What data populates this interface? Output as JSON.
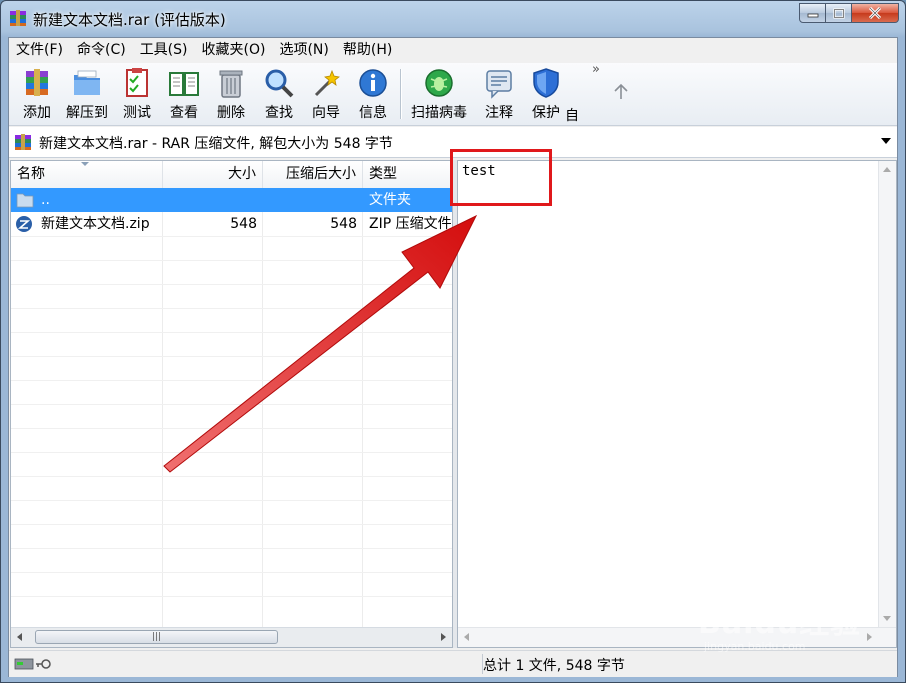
{
  "window": {
    "title": "新建文本文档.rar (评估版本)"
  },
  "menu": [
    "文件(F)",
    "命令(C)",
    "工具(S)",
    "收藏夹(O)",
    "选项(N)",
    "帮助(H)"
  ],
  "toolbar": {
    "add": "添加",
    "extract": "解压到",
    "test": "测试",
    "view": "查看",
    "delete": "删除",
    "find": "查找",
    "wizard": "向导",
    "info": "信息",
    "scan": "扫描病毒",
    "comment": "注释",
    "protect": "保护",
    "sfx": "自",
    "more": "»"
  },
  "address": {
    "text": "新建文本文档.rar - RAR 压缩文件, 解包大小为 548 字节"
  },
  "columns": {
    "name": "名称",
    "size": "大小",
    "packed": "压缩后大小",
    "type": "类型"
  },
  "files": [
    {
      "name": "..",
      "size": "",
      "packed": "",
      "type": "文件夹"
    },
    {
      "name": "新建文本文档.zip",
      "size": "548",
      "packed": "548",
      "type": "ZIP 压缩文件"
    }
  ],
  "preview": {
    "content": "test"
  },
  "status": {
    "summary": "总计 1 文件, 548 字节"
  },
  "watermark": {
    "brand": "Baidu经验",
    "sub": "jingyan.baidu.com"
  },
  "colors": {
    "selection": "#3399ff",
    "highlight": "#e0181b",
    "arrow": "#e01515"
  }
}
